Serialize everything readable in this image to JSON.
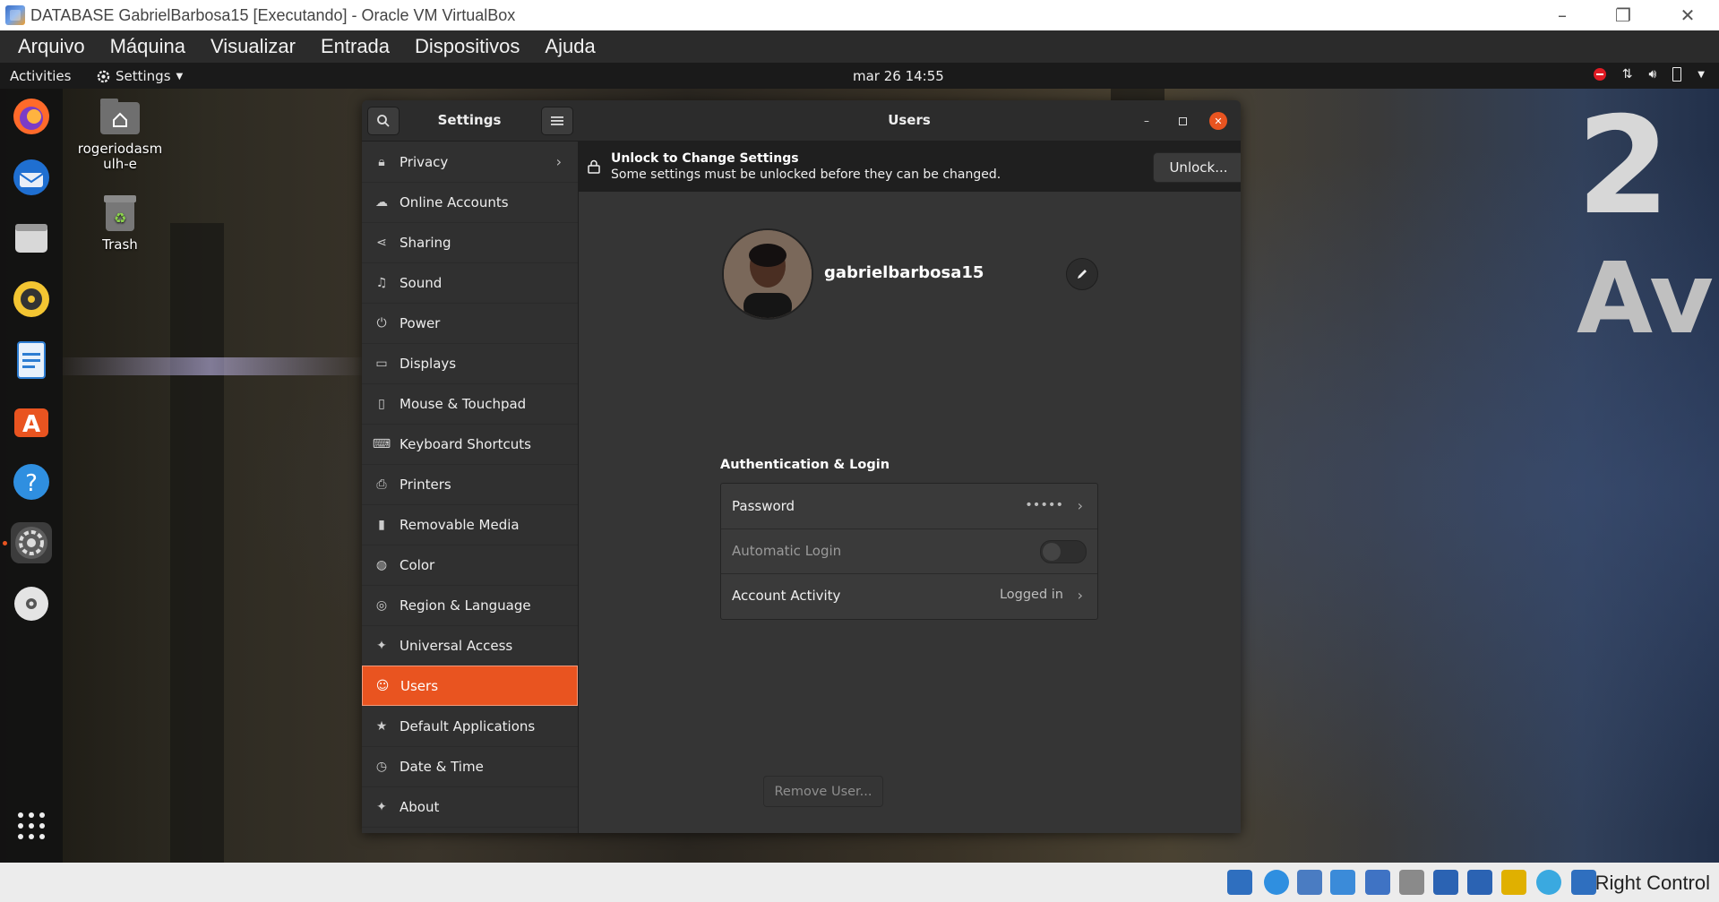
{
  "host_window": {
    "title": "DATABASE GabrielBarbosa15 [Executando] - Oracle VM VirtualBox",
    "minimize": "–",
    "restore": "❐",
    "close": "✕"
  },
  "vbox_menu": [
    "Arquivo",
    "Máquina",
    "Visualizar",
    "Entrada",
    "Dispositivos",
    "Ajuda"
  ],
  "topbar": {
    "activities": "Activities",
    "app_menu": "Settings",
    "clock": "mar 26  14:55"
  },
  "desktop_icons": {
    "home_label": "rogeriodasmulh-e",
    "trash_label": "Trash"
  },
  "settings": {
    "sidebar_title": "Settings",
    "panel_title": "Users",
    "sidebar_items": [
      {
        "label": "Privacy",
        "icon": "lock-icon"
      },
      {
        "label": "Online Accounts",
        "icon": "cloud-icon"
      },
      {
        "label": "Sharing",
        "icon": "share-icon"
      },
      {
        "label": "Sound",
        "icon": "music-note-icon"
      },
      {
        "label": "Power",
        "icon": "power-icon"
      },
      {
        "label": "Displays",
        "icon": "display-icon"
      },
      {
        "label": "Mouse & Touchpad",
        "icon": "mouse-icon"
      },
      {
        "label": "Keyboard Shortcuts",
        "icon": "keyboard-icon"
      },
      {
        "label": "Printers",
        "icon": "printer-icon"
      },
      {
        "label": "Removable Media",
        "icon": "media-icon"
      },
      {
        "label": "Color",
        "icon": "color-icon"
      },
      {
        "label": "Region & Language",
        "icon": "globe-icon"
      },
      {
        "label": "Universal Access",
        "icon": "accessibility-icon"
      },
      {
        "label": "Users",
        "icon": "user-icon",
        "active": true
      },
      {
        "label": "Default Applications",
        "icon": "star-icon"
      },
      {
        "label": "Date & Time",
        "icon": "clock-icon"
      },
      {
        "label": "About",
        "icon": "sparkle-icon"
      }
    ],
    "infobar": {
      "title": "Unlock to Change Settings",
      "message": "Some settings must be unlocked before they can be changed.",
      "unlock_label": "Unlock..."
    },
    "user": {
      "username": "gabrielbarbosa15"
    },
    "auth": {
      "heading": "Authentication & Login",
      "password_label": "Password",
      "password_value": "•••••",
      "autologin_label": "Automatic Login",
      "autologin_on": false,
      "activity_label": "Account Activity",
      "activity_value": "Logged in"
    },
    "remove_user_label": "Remove User..."
  },
  "statusbar": {
    "host_key": "Right Control"
  },
  "colors": {
    "accent": "#e95420",
    "window_bg": "#353535",
    "sidebar_bg": "#303030"
  }
}
